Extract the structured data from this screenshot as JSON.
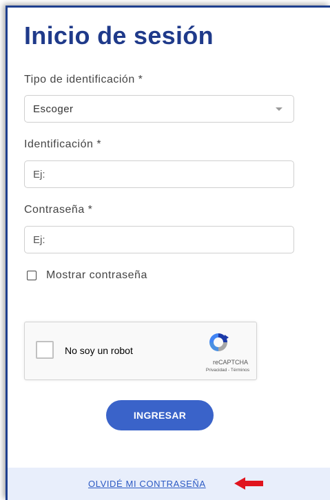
{
  "title": "Inicio de sesión",
  "form": {
    "id_type_label": "Tipo de identificación *",
    "id_type_value": "Escoger",
    "id_label": "Identificación *",
    "id_placeholder": "Ej:",
    "password_label": "Contraseña *",
    "password_placeholder": "Ej:",
    "show_password_label": "Mostrar contraseña"
  },
  "recaptcha": {
    "checkbox_label": "No soy un robot",
    "brand": "reCAPTCHA",
    "links": "Privacidad - Términos"
  },
  "submit_label": "INGRESAR",
  "forgot_password_label": "OLVIDÉ MI CONTRASEÑA",
  "colors": {
    "title": "#1f3a8a",
    "button": "#3a63c9",
    "link": "#2b59c3",
    "arrow": "#e0141e",
    "footer_bg": "#e8eefb"
  }
}
